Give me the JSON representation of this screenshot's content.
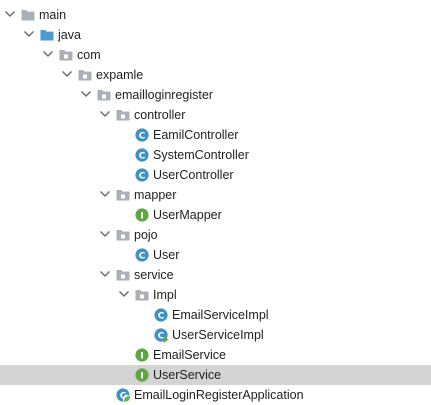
{
  "project_tree": {
    "selected": "UserService",
    "items": [
      {
        "label": "main",
        "type": "folder",
        "expanded": true,
        "depth": 0
      },
      {
        "label": "java",
        "type": "source-root",
        "expanded": true,
        "depth": 1
      },
      {
        "label": "com",
        "type": "package",
        "expanded": true,
        "depth": 2
      },
      {
        "label": "expamle",
        "type": "package",
        "expanded": true,
        "depth": 3
      },
      {
        "label": "emailloginregister",
        "type": "package",
        "expanded": true,
        "depth": 4
      },
      {
        "label": "controller",
        "type": "package",
        "expanded": true,
        "depth": 5
      },
      {
        "label": "EamilController",
        "type": "class",
        "depth": 6
      },
      {
        "label": "SystemController",
        "type": "class",
        "depth": 6
      },
      {
        "label": "UserController",
        "type": "class",
        "depth": 6
      },
      {
        "label": "mapper",
        "type": "package",
        "expanded": true,
        "depth": 5
      },
      {
        "label": "UserMapper",
        "type": "interface",
        "depth": 6
      },
      {
        "label": "pojo",
        "type": "package",
        "expanded": true,
        "depth": 5
      },
      {
        "label": "User",
        "type": "class",
        "depth": 6
      },
      {
        "label": "service",
        "type": "package",
        "expanded": true,
        "depth": 5
      },
      {
        "label": "Impl",
        "type": "package",
        "expanded": true,
        "depth": 6
      },
      {
        "label": "EmailServiceImpl",
        "type": "class",
        "depth": 7
      },
      {
        "label": "UserServiceImpl",
        "type": "class-modified",
        "depth": 7
      },
      {
        "label": "EmailService",
        "type": "interface",
        "depth": 6
      },
      {
        "label": "UserService",
        "type": "interface",
        "depth": 6
      },
      {
        "label": "EmailLoginRegisterApplication",
        "type": "spring-application",
        "depth": 5
      }
    ]
  },
  "colors": {
    "class_icon": "#3e93c4",
    "interface_icon": "#5ea643",
    "folder_icon": "#a9b0b8",
    "source_root_icon": "#4b9bd0",
    "chevron": "#6e6e6e",
    "selection": "#d4d4d4",
    "spring_leaf": "#6db33f"
  }
}
